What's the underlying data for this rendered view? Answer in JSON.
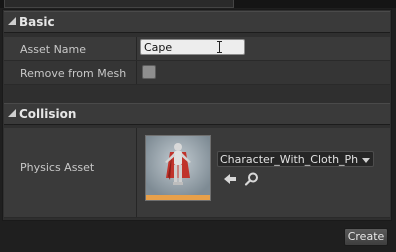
{
  "categories": {
    "basic": {
      "label": "Basic"
    },
    "collision": {
      "label": "Collision"
    }
  },
  "properties": {
    "asset_name": {
      "label": "Asset Name",
      "value": "Cape"
    },
    "remove_from_mesh": {
      "label": "Remove from Mesh",
      "checked": false
    },
    "physics_asset": {
      "label": "Physics Asset",
      "value": "Character_With_Cloth_Physi"
    }
  },
  "icons": {
    "use_selected": "left-arrow-icon",
    "browse": "search-icon",
    "expand": "triangle-icon",
    "combo": "chevron-down-icon"
  },
  "buttons": {
    "create": "Create"
  },
  "colors": {
    "thumbnail_accent": "#e8a04a",
    "cape": "#c0332b"
  }
}
